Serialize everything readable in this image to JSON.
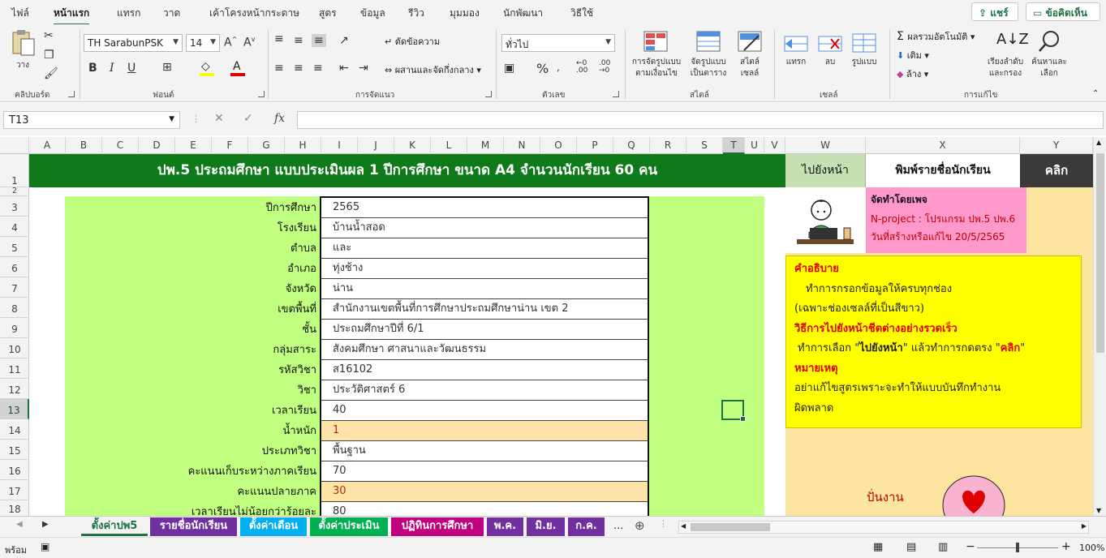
{
  "menu": {
    "tabs": [
      "ไฟล์",
      "หน้าแรก",
      "แทรก",
      "วาด",
      "เค้าโครงหน้ากระดาษ",
      "สูตร",
      "ข้อมูล",
      "รีวิว",
      "มุมมอง",
      "นักพัฒนา",
      "วิธีใช้"
    ],
    "active": "หน้าแรก",
    "share_label": "แชร์",
    "comments_label": "ข้อคิดเห็น"
  },
  "ribbon": {
    "clipboard": {
      "paste": "วาง",
      "group": "คลิปบอร์ด"
    },
    "font": {
      "name": "TH SarabunPSK",
      "size": "14",
      "group": "ฟอนต์",
      "bold": "B",
      "italic": "I",
      "underline": "U"
    },
    "alignment": {
      "wrap": "ตัดข้อความ",
      "merge": "ผสานและจัดกึ่งกลาง",
      "group": "การจัดแนว"
    },
    "number": {
      "format": "ทั่วไป",
      "group": "ตัวเลข",
      "percent": "%"
    },
    "styles": {
      "conditional": "การจัดรูปแบบ\nตามเงื่อนไข",
      "table": "จัดรูปแบบ\nเป็นตาราง",
      "cell": "สไตล์\nเซลล์",
      "group": "สไตล์"
    },
    "cells": {
      "insert": "แทรก",
      "delete": "ลบ",
      "format": "รูปแบบ",
      "group": "เซลล์"
    },
    "editing": {
      "autosum": "ผลรวมอัตโนมัติ",
      "fill": "เติม",
      "clear": "ล้าง",
      "sort": "เรียงลำดับ\nและกรอง",
      "find": "ค้นหาและ\nเลือก",
      "group": "การแก้ไข"
    }
  },
  "formula_bar": {
    "name_box": "T13",
    "fx": "fx",
    "content": ""
  },
  "columns": [
    "A",
    "B",
    "C",
    "D",
    "E",
    "F",
    "G",
    "H",
    "I",
    "J",
    "K",
    "L",
    "M",
    "N",
    "O",
    "P",
    "Q",
    "R",
    "S",
    "T",
    "U",
    "V",
    "W",
    "X",
    "Y"
  ],
  "selected_column": "T",
  "rows": [
    "1",
    "2",
    "3",
    "4",
    "5",
    "6",
    "7",
    "8",
    "9",
    "10",
    "11",
    "12",
    "13",
    "14",
    "15",
    "16",
    "17",
    "18"
  ],
  "selected_row": "13",
  "sheet": {
    "title": "ปพ.5 ประถมศึกษา แบบประเมินผล 1 ปีการศึกษา ขนาด A4 จำนวนนักเรียน 60 คน",
    "goto_label": "ไปยังหน้า",
    "print_label": "พิมพ์รายชื่อนักเรียน",
    "click_label": "คลิก",
    "fields": [
      {
        "label": "ปีการศึกษา",
        "value": "2565",
        "highlight": false
      },
      {
        "label": "โรงเรียน",
        "value": "บ้านน้ำสอด",
        "highlight": false
      },
      {
        "label": "ตำบล",
        "value": "และ",
        "highlight": false
      },
      {
        "label": "อำเภอ",
        "value": "ทุ่งช้าง",
        "highlight": false
      },
      {
        "label": "จังหวัด",
        "value": "น่าน",
        "highlight": false
      },
      {
        "label": "เขตพื้นที่",
        "value": "สำนักงานเขตพื้นที่การศึกษาประถมศึกษาน่าน เขต 2",
        "highlight": false
      },
      {
        "label": "ชั้น",
        "value": "ประถมศึกษาปีที่ 6/1",
        "highlight": false
      },
      {
        "label": "กลุ่มสาระ",
        "value": "สังคมศึกษา ศาสนาและวัฒนธรรม",
        "highlight": false
      },
      {
        "label": "รหัสวิชา",
        "value": "ส16102",
        "highlight": false
      },
      {
        "label": "วิชา",
        "value": "ประวัติศาสตร์ 6",
        "highlight": false
      },
      {
        "label": "เวลาเรียน",
        "value": "40",
        "highlight": false
      },
      {
        "label": "น้ำหนัก",
        "value": "1",
        "highlight": true
      },
      {
        "label": "ประเภทวิชา",
        "value": "พื้นฐาน",
        "highlight": false
      },
      {
        "label": "คะแนนเก็บระหว่างภาคเรียน",
        "value": "70",
        "highlight": false
      },
      {
        "label": "คะแนนปลายภาค",
        "value": "30",
        "highlight": true
      },
      {
        "label": "เวลาเรียนไม่น้อยกว่าร้อยละ",
        "value": "80",
        "highlight": false
      }
    ],
    "author": {
      "made_by": "จัดทำโดยเพจ",
      "project": "N-project : โปรแกรม ปพ.5 ปพ.6",
      "date": "วันที่สร้างหรือแก้ไข 20/5/2565"
    },
    "instructions": {
      "heading": "คำอธิบาย",
      "line1": "ทำการกรอกข้อมูลให้ครบทุกช่อง",
      "line2": "(เฉพาะช่องเซลล์ที่เป็นสีขาว)",
      "heading2": "วิธีการไปยังหน้าชีตต่างอย่างรวดเร็ว",
      "line3_a": "ทำการเลือก \"",
      "line3_b": "ไปยังหน้า",
      "line3_c": "\" แล้วทำการกดตรง \"",
      "line3_d": "คลิก",
      "line3_e": "\"",
      "heading3": "หมายเหตุ",
      "line4": "อย่าแก้ไขสูตรเพราะจะทำให้แบบบันทึกทำงาน",
      "line5": "ผิดพลาด"
    },
    "footer_note": "ปั่นงาน"
  },
  "sheet_tabs": [
    {
      "label": "ตั้งค่าปพ5",
      "color": "#f3f3f3",
      "text": "#1e7145",
      "active": true
    },
    {
      "label": "รายชื่อนักเรียน",
      "color": "#7030a0",
      "text": "#ffffff",
      "active": false
    },
    {
      "label": "ตั้งค่าเดือน",
      "color": "#00b0f0",
      "text": "#ffffff",
      "active": false
    },
    {
      "label": "ตั้งค่าประเมิน",
      "color": "#00b050",
      "text": "#ffffff",
      "active": false
    },
    {
      "label": "ปฏิทินการศึกษา",
      "color": "#c00080",
      "text": "#ffffff",
      "active": false
    },
    {
      "label": "พ.ค.",
      "color": "#7030a0",
      "text": "#ffffff",
      "active": false
    },
    {
      "label": "มิ.ย.",
      "color": "#7030a0",
      "text": "#ffffff",
      "active": false
    },
    {
      "label": "ก.ค.",
      "color": "#7030a0",
      "text": "#ffffff",
      "active": false
    }
  ],
  "tabs_more": "...",
  "status": {
    "ready": "พร้อม",
    "zoom": "100%"
  }
}
